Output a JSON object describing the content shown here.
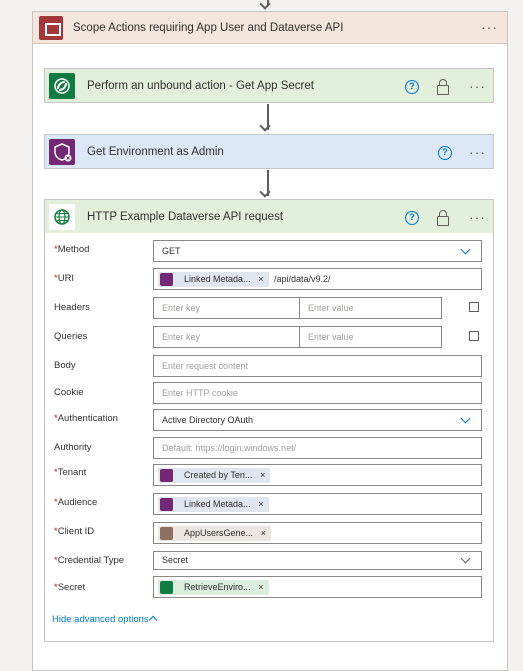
{
  "scope": {
    "title": "Scope Actions requiring App User and Dataverse API",
    "menu": "···"
  },
  "actions": [
    {
      "title": "Perform an unbound action - Get App Secret",
      "color": "#e2efdb",
      "icon_color": "#107c41"
    },
    {
      "title": "Get Environment as Admin",
      "color": "#dce7f7",
      "icon_color": "#742774"
    }
  ],
  "http": {
    "title": "HTTP Example Dataverse API request",
    "help": "?",
    "menu": "···",
    "fields": {
      "method": {
        "label": "Method",
        "value": "GET"
      },
      "uri": {
        "label": "URI",
        "token": "Linked Metada...",
        "suffix": "/api/data/v9.2/"
      },
      "headers": {
        "label": "Headers",
        "key_ph": "Enter key",
        "value_ph": "Enter value"
      },
      "queries": {
        "label": "Queries",
        "key_ph": "Enter key",
        "value_ph": "Enter value"
      },
      "body": {
        "label": "Body",
        "placeholder": "Enter request content"
      },
      "cookie": {
        "label": "Cookie",
        "placeholder": "Enter HTTP cookie"
      },
      "authentication": {
        "label": "Authentication",
        "value": "Active Directory OAuth"
      },
      "authority": {
        "label": "Authority",
        "placeholder": "Default: https://login.windows.net/"
      },
      "tenant": {
        "label": "Tenant",
        "token": "Created by Ten..."
      },
      "audience": {
        "label": "Audience",
        "token": "Linked Metada..."
      },
      "client_id": {
        "label": "Client ID",
        "token": "AppUsersGene..."
      },
      "credential_type": {
        "label": "Credential Type",
        "value": "Secret"
      },
      "secret": {
        "label": "Secret",
        "token": "RetrieveEnviro..."
      }
    },
    "advanced_link": "Hide advanced options"
  },
  "required_mark": "*",
  "token_remove": "×",
  "colors": {
    "http_header": "#e2efdb",
    "dataverse_green": "#107c41",
    "purple": "#742774",
    "link": "#0078d4"
  }
}
